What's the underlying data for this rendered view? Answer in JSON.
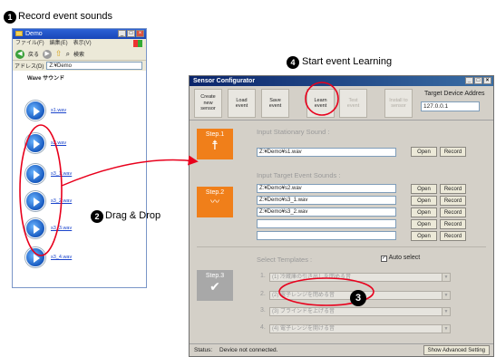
{
  "callouts": {
    "step1": {
      "num": "1",
      "text": "Record event sounds"
    },
    "step2": {
      "num": "2",
      "text": "Drag & Drop"
    },
    "step3": {
      "num": "3"
    },
    "step4": {
      "num": "4",
      "text": "Start event Learning"
    }
  },
  "explorer": {
    "title": "Demo",
    "menu": [
      "ファイル(F)",
      "編集(E)",
      "表示(V)"
    ],
    "toolbar": {
      "back_label": "戻る",
      "search_label": "検索"
    },
    "address_label": "アドレス(D)",
    "address_value": "Z:¥Demo",
    "folder_heading": "Wave サウンド",
    "files": [
      "s1.wav",
      "s2.wav",
      "s3_1.wav",
      "s3_2.wav",
      "s3_3.wav",
      "s3_4.wav"
    ]
  },
  "sensor": {
    "title": "Sensor Configurator",
    "toolbar": [
      {
        "label": "Create new sensor",
        "enabled": true
      },
      {
        "label": "Load event",
        "enabled": true
      },
      {
        "label": "Save event",
        "enabled": true
      },
      {
        "label": "Learn event",
        "enabled": true
      },
      {
        "label": "Test event",
        "enabled": false
      },
      {
        "label": "Install to sensor",
        "enabled": false
      }
    ],
    "target_label": "Target Device Addres",
    "target_value": "127.0.0.1",
    "step1": {
      "label": "Step.1",
      "section": "Input Stationary Sound :",
      "file": "Z:¥Demo¥s1.wav"
    },
    "step2": {
      "label": "Step.2",
      "section": "Input Target Event Sounds :",
      "files": [
        "Z:¥Demo¥s2.wav",
        "Z:¥Demo¥s3_1.wav",
        "Z:¥Demo¥s3_2.wav",
        "",
        ""
      ]
    },
    "step3": {
      "label": "Step.3",
      "section": "Select Templates :",
      "auto_select_label": "Auto select",
      "auto_select_checked": true,
      "templates": [
        {
          "num": "1.",
          "value": "(1) 冷蔵庫の引き出しを閉める音"
        },
        {
          "num": "2.",
          "value": "(2) 電子レンジを閉める音"
        },
        {
          "num": "3.",
          "value": "(3) ブラインドを上げる音"
        },
        {
          "num": "4.",
          "value": "(4) 電子レンジを開ける音"
        }
      ]
    },
    "buttons": {
      "open": "Open",
      "record": "Record"
    },
    "status_label": "Status:",
    "status_value": "Device not connected.",
    "advanced_button": "Show Advanced Setting"
  },
  "colors": {
    "accent_orange": "#f07f1a",
    "highlight_red": "#e8001c",
    "step_gray": "#a8a8a8"
  }
}
